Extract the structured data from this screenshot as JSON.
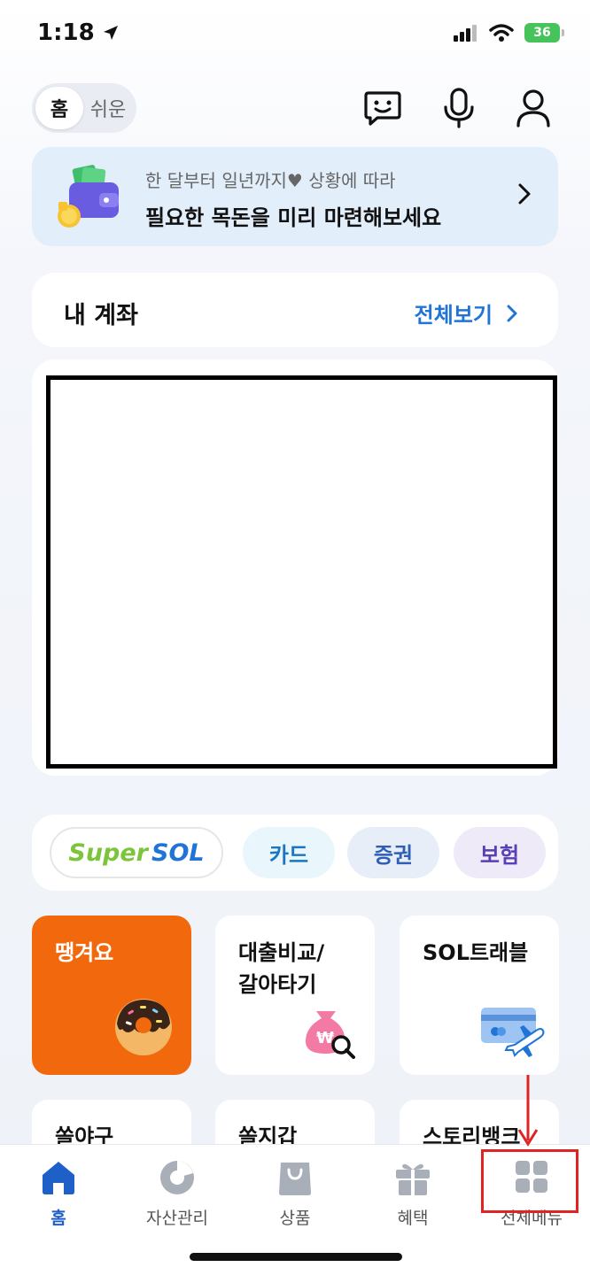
{
  "status_bar": {
    "time": "1:18",
    "battery": "36"
  },
  "header": {
    "mode_active": "홈",
    "mode_inactive": "쉬운",
    "icons": [
      "chat-bot-icon",
      "microphone-icon",
      "profile-icon"
    ]
  },
  "banner": {
    "subtitle": "한 달부터 일년까지♥ 상황에 따라",
    "title": "필요한 목돈을 미리 마련해보세요"
  },
  "account": {
    "title": "내 계좌",
    "view_all": "전체보기"
  },
  "quick_links": {
    "supersol": "Super SOL",
    "card": "카드",
    "stock": "증권",
    "insurance": "보험"
  },
  "tiles": [
    {
      "title": "땡겨요"
    },
    {
      "title": "대출비교/\n갈아타기"
    },
    {
      "title": "SOL트래블"
    },
    {
      "title": "쏠야구"
    },
    {
      "title": "쏠지갑"
    },
    {
      "title": "스토리뱅크"
    }
  ],
  "bottom_nav": [
    {
      "label": "홈"
    },
    {
      "label": "자산관리"
    },
    {
      "label": "상품"
    },
    {
      "label": "혜택"
    },
    {
      "label": "전체메뉴"
    }
  ],
  "colors": {
    "accent_blue": "#1f74d6",
    "tile_orange": "#f2680c",
    "annotation_red": "#e02424"
  }
}
